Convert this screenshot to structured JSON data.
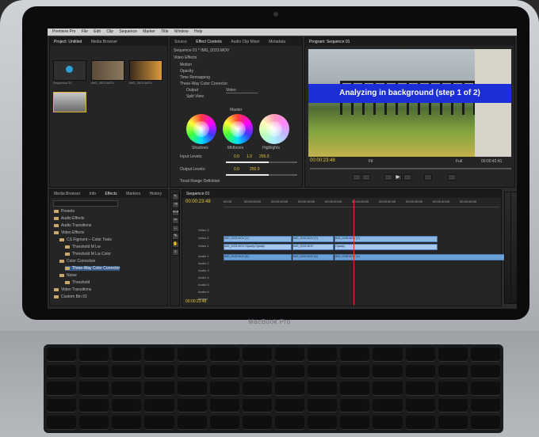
{
  "laptop": {
    "brand": "MacBook Pro"
  },
  "app": {
    "menu": [
      "Premiere Pro",
      "File",
      "Edit",
      "Clip",
      "Sequence",
      "Marker",
      "Title",
      "Window",
      "Help"
    ]
  },
  "project_panel": {
    "tabs": [
      "Project: Untitled",
      "Media Browser"
    ],
    "clips": [
      {
        "label": "Sequence 01"
      },
      {
        "label": "IMG_0023.MOV"
      },
      {
        "label": "IMG_0024.MOV"
      }
    ]
  },
  "effect_controls": {
    "tabs": [
      "Source",
      "Effect Controls",
      "Audio Clip Mixer",
      "Metadata"
    ],
    "sequence": "Sequence 01 * IMG_0023.MOV",
    "video_effects": "Video Effects",
    "items": [
      "Motion",
      "Opacity",
      "Time Remapping",
      "Three-Way Color Corrector"
    ],
    "output_label": "Output",
    "output_value": "Video",
    "split_view": "Split View",
    "master": "Master",
    "wheels": [
      "Shadows",
      "Midtones",
      "Highlights"
    ],
    "input_levels_label": "Input Levels:",
    "input_levels_values": [
      "0.0",
      "1.0",
      "255.0"
    ],
    "output_levels_label": "Output Levels:",
    "output_levels_values": [
      "0.0",
      "255.0"
    ],
    "tonal_range": "Tonal Range Definition",
    "timecode": "00:00:23:48"
  },
  "program_monitor": {
    "tabs": [
      "Program: Sequence 01"
    ],
    "banner": "Analyzing in background (step 1 of 2)",
    "timecode_left": "00:00:23:48",
    "fit": "Fit",
    "full": "Full",
    "timecode_right": "00:00:42:41"
  },
  "effects_panel": {
    "tabs": [
      "Media Browser",
      "Info",
      "Effects",
      "Markers",
      "History"
    ],
    "search_placeholder": "",
    "items": [
      {
        "label": "Presets",
        "indent": 0
      },
      {
        "label": "Audio Effects",
        "indent": 0
      },
      {
        "label": "Audio Transitions",
        "indent": 0
      },
      {
        "label": "Video Effects",
        "indent": 0
      },
      {
        "label": "CS Figment – Color Tools",
        "indent": 1
      },
      {
        "label": "Threshold M Lw",
        "indent": 2
      },
      {
        "label": "Threshold M Lw Color",
        "indent": 2
      },
      {
        "label": "Color Correction",
        "indent": 1
      },
      {
        "label": "Three-Way Color Corrector",
        "indent": 2,
        "selected": true
      },
      {
        "label": "Noise",
        "indent": 1
      },
      {
        "label": "Threshold",
        "indent": 2
      },
      {
        "label": "Video Transitions",
        "indent": 0
      },
      {
        "label": "Custom Bin 01",
        "indent": 0
      }
    ]
  },
  "timeline": {
    "tab": "Sequence 01",
    "timecode": "00:00:23:48",
    "ruler": [
      "00:00",
      "00:00:05:00",
      "00:00:10:00",
      "00:00:15:00",
      "00:00:20:00",
      "00:00:25:00",
      "00:00:30:00",
      "00:00:35:00",
      "00:00:40:00",
      "00:00:45:00"
    ],
    "tracks": [
      "Video 3",
      "Video 2",
      "Video 1",
      "Audio 1",
      "Audio 2",
      "Audio 3",
      "Audio 4",
      "Audio 5",
      "Audio 6",
      "Master"
    ],
    "clips_v2": [
      "IMG_0023.MOV [V]",
      "IMG_0024.MOV [V]",
      "IMG_0025.MOV [V]"
    ],
    "clips_v1": [
      "IMG_0023.MOV Opacity:Opacity",
      "IMG_0024.MOV",
      "Opacity"
    ],
    "clips_a1": [
      "IMG_0023.MOV [A]",
      "IMG_0024.MOV [A]",
      "IMG_0025.MOV [A]"
    ],
    "bottom_timecode": "00:00:23:48"
  }
}
